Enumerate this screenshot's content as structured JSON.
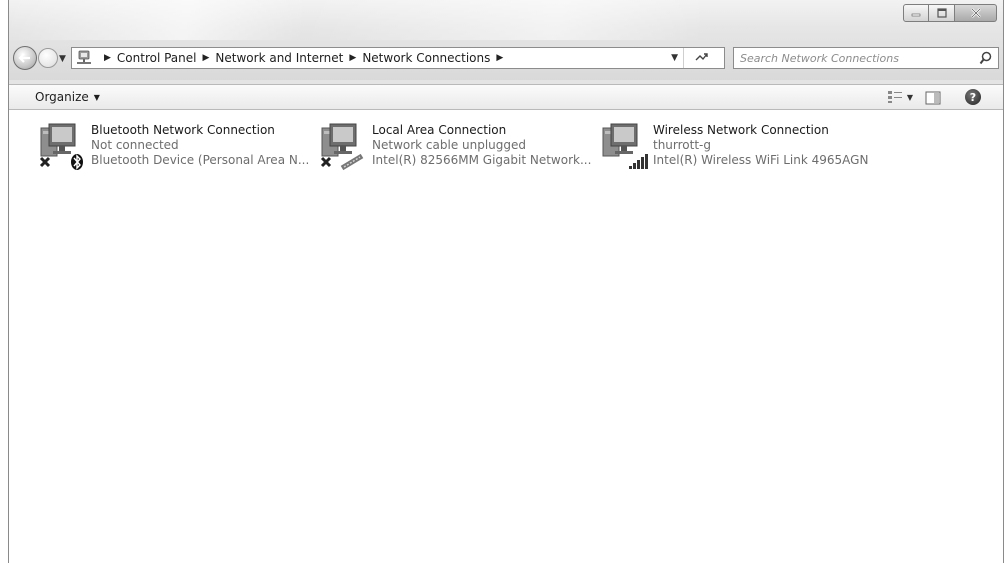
{
  "window": {
    "buttons": {
      "minimize": "minimize-icon",
      "maximize": "maximize-icon",
      "close": "close-icon"
    }
  },
  "address_bar": {
    "breadcrumbs": [
      "Control Panel",
      "Network and Internet",
      "Network Connections"
    ]
  },
  "search": {
    "placeholder": "Search Network Connections"
  },
  "toolbar": {
    "organize_label": "Organize"
  },
  "connections": [
    {
      "name": "Bluetooth Network Connection",
      "status": "Not connected",
      "device": "Bluetooth Device (Personal Area N...",
      "state_icon": "disconnected-x-icon",
      "adapter_icon": "bluetooth-icon"
    },
    {
      "name": "Local Area Connection",
      "status": "Network cable unplugged",
      "device": "Intel(R) 82566MM Gigabit Network...",
      "state_icon": "disconnected-x-icon",
      "adapter_icon": "ethernet-cable-icon"
    },
    {
      "name": "Wireless Network Connection",
      "status": "thurrott-g",
      "device": "Intel(R) Wireless WiFi Link 4965AGN",
      "state_icon": "signal-strength-icon",
      "adapter_icon": ""
    }
  ]
}
